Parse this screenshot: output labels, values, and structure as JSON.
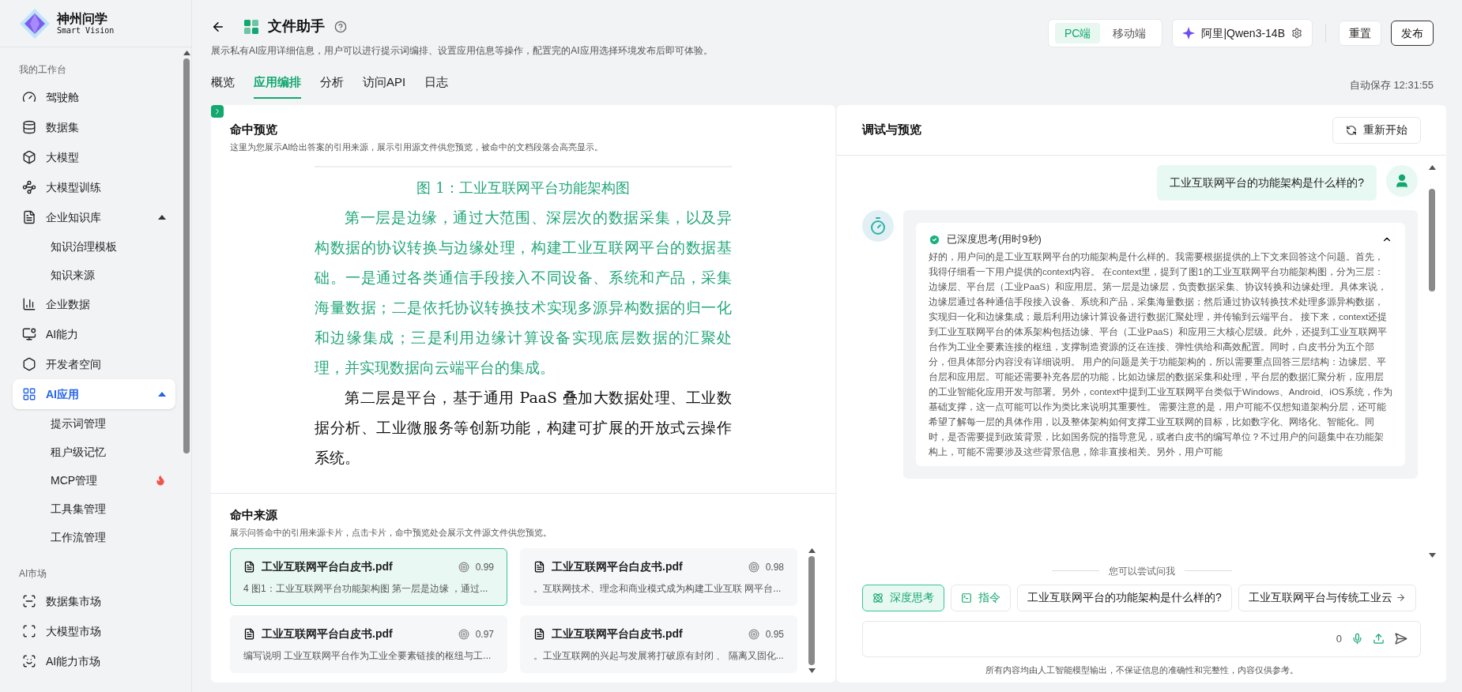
{
  "brand": {
    "name": "神州问学",
    "tagline": "Smart Vision"
  },
  "sidebar": {
    "sections": [
      {
        "label": "我的工作台",
        "items": [
          {
            "label": "驾驶舱",
            "selected": false
          },
          {
            "label": "数据集",
            "selected": false
          },
          {
            "label": "大模型",
            "selected": false
          },
          {
            "label": "大模型训练",
            "selected": false
          },
          {
            "label": "企业知识库",
            "selected": false,
            "expanded": true,
            "children": [
              {
                "label": "知识治理模板",
                "hot": false
              },
              {
                "label": "知识来源",
                "hot": false
              }
            ]
          },
          {
            "label": "企业数据",
            "selected": false
          },
          {
            "label": "AI能力",
            "selected": false
          },
          {
            "label": "开发者空间",
            "selected": false
          },
          {
            "label": "AI应用",
            "selected": true,
            "expanded": true,
            "children": [
              {
                "label": "提示词管理",
                "hot": false
              },
              {
                "label": "租户级记忆",
                "hot": false
              },
              {
                "label": "MCP管理",
                "hot": true
              },
              {
                "label": "工具集管理",
                "hot": false
              },
              {
                "label": "工作流管理",
                "hot": false
              }
            ]
          }
        ]
      },
      {
        "label": "AI市场",
        "items": [
          {
            "label": "数据集市场",
            "selected": false
          },
          {
            "label": "大模型市场",
            "selected": false
          },
          {
            "label": "AI能力市场",
            "selected": false
          }
        ]
      }
    ]
  },
  "header": {
    "title": "文件助手",
    "description": "展示私有AI应用详细信息，用户可以进行提示词编排、设置应用信息等操作，配置完的AI应用选择环境发布后即可体验。",
    "platforms": [
      {
        "label": "PC端",
        "selected": true
      },
      {
        "label": "移动端",
        "selected": false
      }
    ],
    "model": "阿里|Qwen3-14B",
    "buttons": [
      {
        "label": "重置",
        "kind": "secondary"
      },
      {
        "label": "发布",
        "kind": "primary"
      }
    ]
  },
  "tabs": [
    {
      "label": "概览",
      "selected": false
    },
    {
      "label": "应用编排",
      "selected": true
    },
    {
      "label": "分析",
      "selected": false
    },
    {
      "label": "访问API",
      "selected": false
    },
    {
      "label": "日志",
      "selected": false
    }
  ],
  "autosave": "自动保存 12:31:55",
  "preview": {
    "title": "命中预览",
    "description": "这里为您展示AI给出答案的引用来源，展示引用源文件供您预览，被命中的文档段落会高亮显示。",
    "document": [
      {
        "kind": "caption",
        "text": "图 1：工业互联网平台功能架构图",
        "highlighted": true
      },
      {
        "kind": "paragraph",
        "text": "第一层是边缘，通过大范围、深层次的数据采集，以及异构数据的协议转换与边缘处理，构建工业互联网平台的数据基础。一是通过各类通信手段接入不同设备、系统和产品，采集海量数据；二是依托协议转换技术实现多源异构数据的归一化和边缘集成；三是利用边缘计算设备实现底层数据的汇聚处理，并实现数据向云端平台的集成。",
        "highlighted": true
      },
      {
        "kind": "paragraph",
        "text": "第二层是平台，基于通用 PaaS 叠加大数据处理、工业数据分析、工业微服务等创新功能，构建可扩展的开放式云操作系统。",
        "highlighted": false
      }
    ]
  },
  "sources": {
    "title": "命中来源",
    "description": "展示问答命中的引用来源卡片，点击卡片，命中预览处会展示文件源文件供您预览。",
    "cards": [
      {
        "name": "工业互联网平台白皮书.pdf",
        "score": "0.99",
        "snippet": "4 图1：工业互联网平台功能架构图 第一层是边缘 ，通过...",
        "selected": true
      },
      {
        "name": "工业互联网平台白皮书.pdf",
        "score": "0.98",
        "snippet": "。互联网技术、理念和商业模式成为构建工业互联 网平台...",
        "selected": false
      },
      {
        "name": "工业互联网平台白皮书.pdf",
        "score": "0.97",
        "snippet": "编写说明 工业互联网平台作为工业全要素链接的枢纽与工...",
        "selected": false
      },
      {
        "name": "工业互联网平台白皮书.pdf",
        "score": "0.95",
        "snippet": "。工业互联网的兴起与发展将打破原有封闭 、 隔离又固化...",
        "selected": false
      }
    ]
  },
  "chat": {
    "title": "调试与预览",
    "restart": "重新开始",
    "question": "工业互联网平台的功能架构是什么样的?",
    "thinking": {
      "label": "已深度思考(用时9秒)",
      "expanded": true,
      "text": "好的，用户问的是工业互联网平台的功能架构是什么样的。我需要根据提供的上下文来回答这个问题。首先，我得仔细看一下用户提供的context内容。 在context里，提到了图1的工业互联网平台功能架构图，分为三层：边缘层、平台层（工业PaaS）和应用层。第一层是边缘层，负责数据采集、协议转换和边缘处理。具体来说，边缘层通过各种通信手段接入设备、系统和产品，采集海量数据；然后通过协议转换技术处理多源异构数据，实现归一化和边缘集成；最后利用边缘计算设备进行数据汇聚处理，并传输到云端平台。 接下来，context还提到工业互联网平台的体系架构包括边缘、平台（工业PaaS）和应用三大核心层级。此外，还提到工业互联网平台作为工业全要素连接的枢纽，支撑制造资源的泛在连接、弹性供给和高效配置。同时，白皮书分为五个部分，但具体部分内容没有详细说明。 用户的问题是关于功能架构的，所以需要重点回答三层结构：边缘层、平台层和应用层。可能还需要补充各层的功能，比如边缘层的数据采集和处理，平台层的数据汇聚分析，应用层的工业智能化应用开发与部署。另外，context中提到工业互联网平台类似于Windows、Android、iOS系统，作为基础支撑，这一点可能可以作为类比来说明其重要性。 需要注意的是，用户可能不仅想知道架构分层，还可能希望了解每一层的具体作用，以及整体架构如何支撑工业互联网的目标，比如数字化、网络化、智能化。同时，是否需要提到政策背景，比如国务院的指导意见，或者白皮书的编写单位？不过用户的问题集中在功能架构上，可能不需要涉及这些背景信息，除非直接相关。另外，用户可能"
    },
    "suggest_label": "您可以尝试问我",
    "modes": [
      {
        "label": "深度思考",
        "selected": true
      },
      {
        "label": "指令",
        "selected": false
      }
    ],
    "suggestions": [
      "工业互联网平台的功能架构是什么样的?",
      "工业互联网平台与传统工业云"
    ],
    "counter": "0",
    "disclaimer": "所有内容均由人工智能模型输出，不保证信息的准确性和完整性，内容仅供参考。"
  }
}
